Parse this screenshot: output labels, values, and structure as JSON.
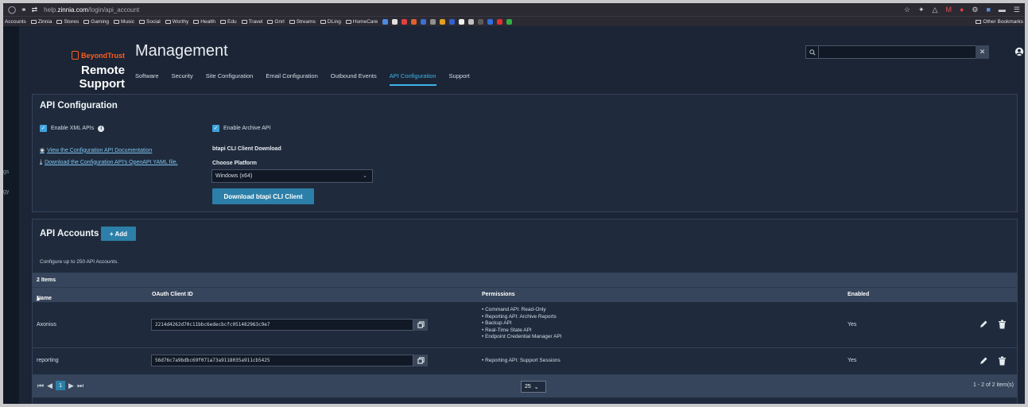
{
  "browser": {
    "url_prefix": "help.",
    "url_domain": "zinnia.com",
    "url_path": "/login/api_account",
    "bookmarks": [
      "Accounts",
      "Zinnia",
      "Stores",
      "Gaming",
      "Music",
      "Social",
      "Worthy",
      "Health",
      "Edu",
      "Travel",
      "Gnrl",
      "Streams",
      "DLing",
      "HomeCare"
    ],
    "other_bookmarks": "Other Bookmarks"
  },
  "leftnav": {
    "frag1": "gs",
    "frag2": "gy"
  },
  "header": {
    "brand": "BeyondTrust",
    "product": "Remote Support",
    "title": "Management",
    "tabs": [
      {
        "label": "Software"
      },
      {
        "label": "Security"
      },
      {
        "label": "Site Configuration"
      },
      {
        "label": "Email Configuration"
      },
      {
        "label": "Outbound Events"
      },
      {
        "label": "API Configuration"
      },
      {
        "label": "Support"
      }
    ],
    "search_placeholder": ""
  },
  "api_config": {
    "title": "API Configuration",
    "enable_xml": "Enable XML APIs",
    "enable_archive": "Enable Archive API",
    "link_docs": "View the Configuration API Documentation",
    "link_yaml": "Download the Configuration API's OpenAPI YAML file.",
    "cli_heading": "btapi CLI Client Download",
    "platform_label": "Choose Platform",
    "platform_value": "Windows (x64)",
    "download_button": "Download btapi CLI Client"
  },
  "api_accounts": {
    "title": "API Accounts",
    "add_button": "+ Add",
    "description": "Configure up to 250 API Accounts.",
    "item_count": "2 Items",
    "columns": {
      "name": "Name",
      "client_id": "OAuth Client ID",
      "permissions": "Permissions",
      "enabled": "Enabled"
    },
    "rows": [
      {
        "name": "Axonius",
        "client_id": "2214d4262d70c11bbc6edecbcfc051482963c9e7",
        "permissions": [
          "Command API: Read-Only",
          "Reporting API: Archive Reports",
          "Backup API",
          "Real-Time State API",
          "Endpoint Credential Manager API"
        ],
        "enabled": "Yes"
      },
      {
        "name": "reporting",
        "client_id": "56d76c7a9bdbc69f071a73a9118035a911cb5425",
        "permissions": [
          "Reporting API: Support Sessions"
        ],
        "enabled": "Yes"
      }
    ],
    "pager": {
      "current_page": "1",
      "page_size": "25",
      "info": "1 - 2 of 2 item(s)"
    }
  },
  "colors": {
    "accent": "#3fb3e8",
    "button": "#2c7fa8",
    "brand": "#ff5c1a",
    "panel": "#1f2b3d"
  }
}
